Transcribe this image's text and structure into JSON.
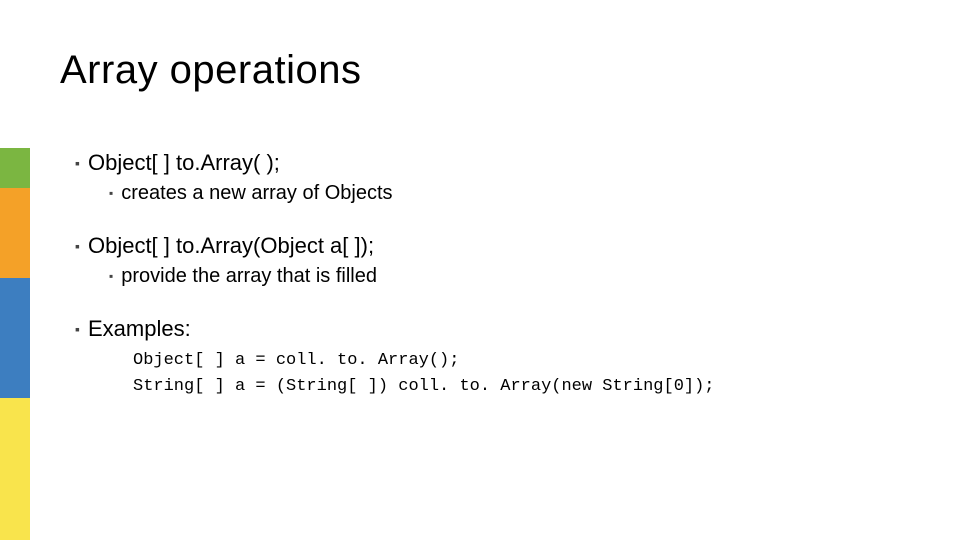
{
  "title": "Array operations",
  "items": [
    {
      "text": "Object[ ] to.Array( );",
      "sub": "creates a new array of Objects"
    },
    {
      "text": "Object[ ] to.Array(Object a[ ]);",
      "sub": "provide the array that is filled"
    },
    {
      "text": "Examples:",
      "code": [
        "Object[ ] a = coll. to. Array();",
        "String[ ] a = (String[ ]) coll. to. Array(new String[0]);"
      ]
    }
  ]
}
